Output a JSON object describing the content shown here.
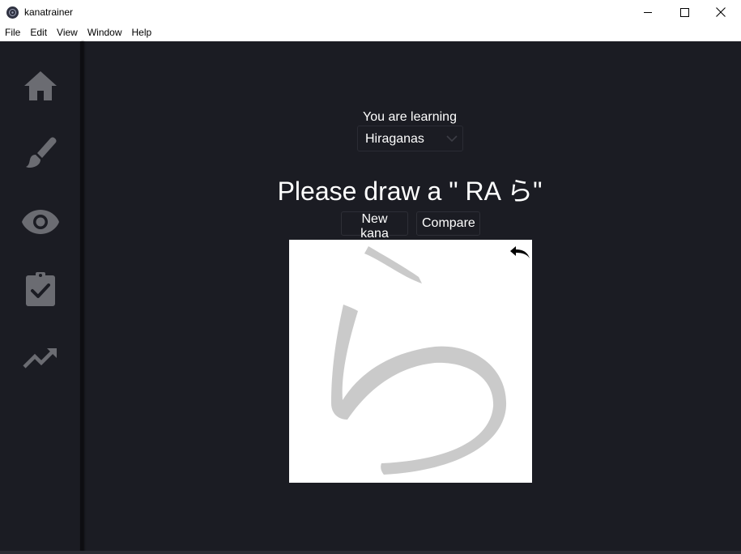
{
  "window": {
    "title": "kanatrainer"
  },
  "menu": {
    "items": [
      "File",
      "Edit",
      "View",
      "Window",
      "Help"
    ]
  },
  "sidebar": {
    "items": [
      {
        "icon": "home-icon"
      },
      {
        "icon": "brush-icon"
      },
      {
        "icon": "eye-icon"
      },
      {
        "icon": "clipboard-check-icon"
      },
      {
        "icon": "trending-up-icon"
      }
    ],
    "icon_color": "#6b6c72"
  },
  "main": {
    "learning_label": "You are learning",
    "learning_select": {
      "value": "Hiraganas"
    },
    "prompt": "Please draw a \" RA ら\"",
    "buttons": {
      "new_kana": "New kana",
      "compare": "Compare"
    },
    "canvas": {
      "guide_kana": "ら",
      "guide_color": "#cacaca",
      "background": "#ffffff"
    }
  },
  "colors": {
    "app_bg": "#1b1c23",
    "text": "#ffffff"
  }
}
